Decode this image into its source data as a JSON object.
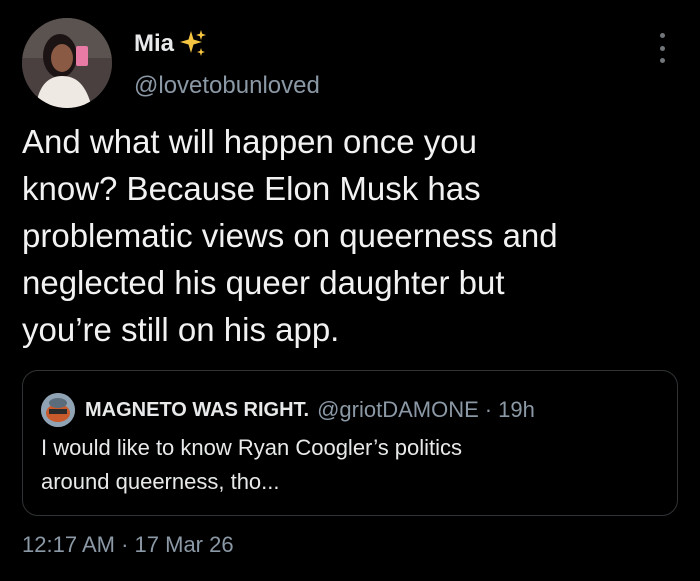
{
  "author": {
    "display_name": "Mia",
    "handle": "@lovetobunloved"
  },
  "icons": {
    "sparkle": "sparkles-emoji-icon",
    "more": "more-options-icon"
  },
  "tweet": {
    "text": "And what will happen once you\nknow? Because Elon Musk has\nproblematic views on queerness and\nneglected his queer daughter but\nyou’re still on his app."
  },
  "quote": {
    "display_name": "MAGNETO WAS RIGHT.",
    "handle": "@griotDAMONE",
    "separator": "·",
    "time": "19h",
    "text": "I would like to know Ryan Coogler’s politics\naround queerness, tho..."
  },
  "meta": {
    "time": "12:17 AM",
    "separator": "·",
    "date": "17 Mar 26"
  },
  "colors": {
    "background": "#000000",
    "text": "#e7e9ea",
    "secondary_text": "#8b98a5",
    "border": "#2f3336",
    "sparkle": "#f5c542"
  }
}
